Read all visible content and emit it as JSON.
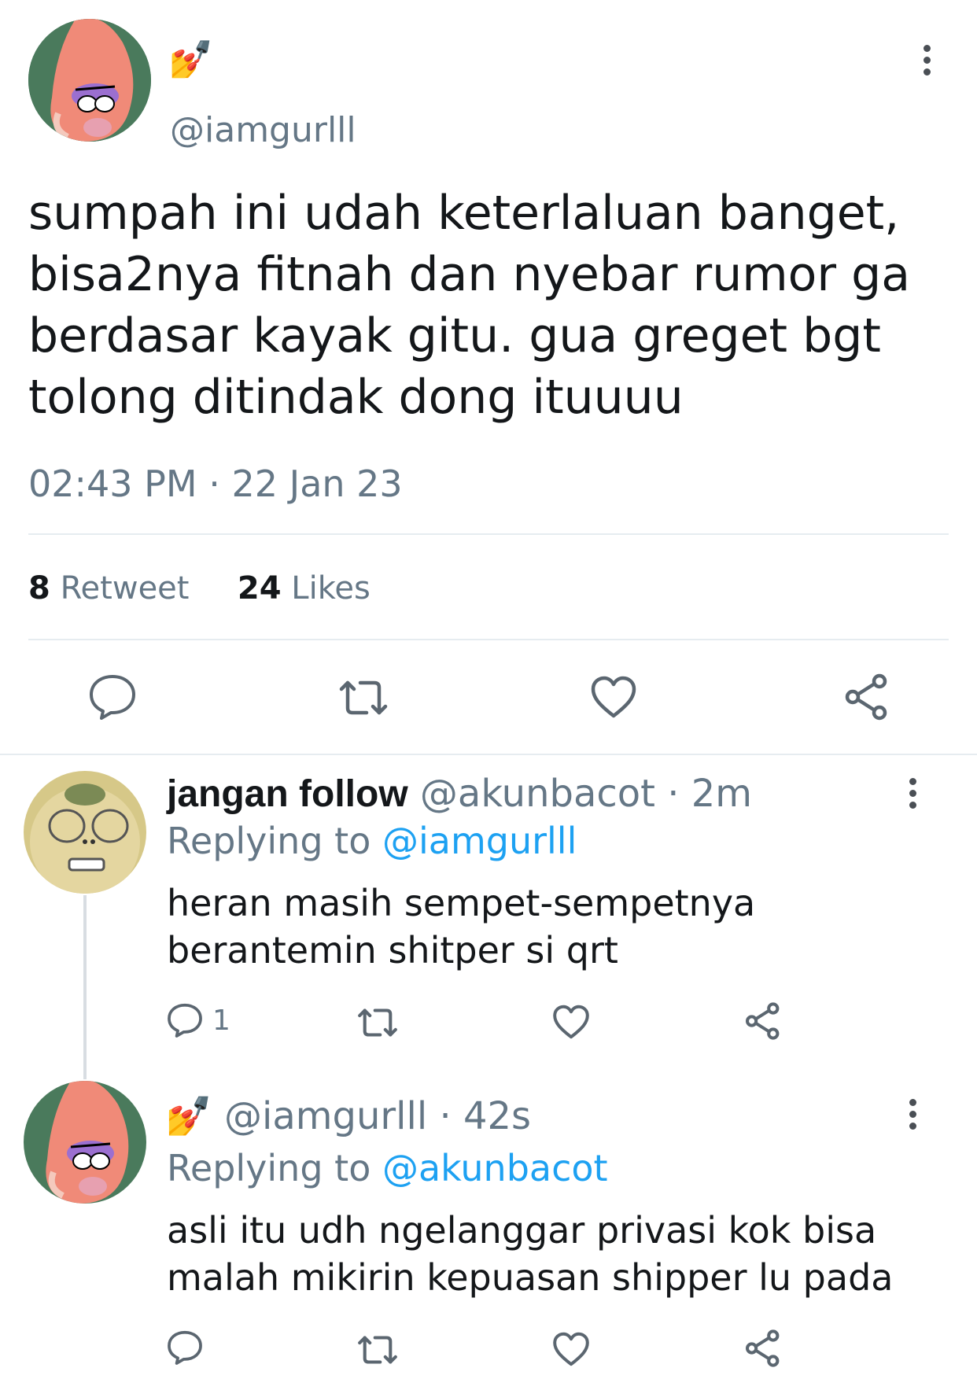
{
  "main_tweet": {
    "name_emoji": "💅",
    "handle": "@iamgurlll",
    "text_lines": [
      "sumpah ini udah keterlaluan banget,",
      "bisa2nya fitnah dan nyebar rumor ga",
      "berdasar kayak gitu. gua greget bgt",
      "tolong ditindak dong ituuuu"
    ],
    "timestamp": "02:43 PM · 22 Jan 23",
    "retweet_count": "8",
    "retweet_label": "Retweet",
    "likes_count": "24",
    "likes_label": "Likes"
  },
  "replies": [
    {
      "name": "jangan follow",
      "handle": "@akunbacot",
      "sep": "·",
      "time": "2m",
      "replying_label": "Replying to",
      "replying_handle": "@iamgurlll",
      "text_lines": [
        "heran masih sempet-sempetnya",
        "berantemin shitper si qrt"
      ],
      "reply_count": "1"
    },
    {
      "name_emoji": "💅",
      "handle": "@iamgurlll",
      "sep": "·",
      "time": "42s",
      "replying_label": "Replying to",
      "replying_handle": "@akunbacot",
      "text_lines": [
        "asli itu udh ngelanggar privasi kok bisa",
        "malah mikirin kepuasan shipper lu pada"
      ],
      "reply_count": ""
    }
  ],
  "icons": {
    "reply": "reply-icon",
    "retweet": "retweet-icon",
    "like": "heart-icon",
    "share": "share-icon",
    "more": "more-options-icon"
  },
  "colors": {
    "text": "#14171a",
    "muted": "#657786",
    "link": "#1da1f2",
    "divider": "#e6ecf0",
    "icon": "#5b6670"
  }
}
